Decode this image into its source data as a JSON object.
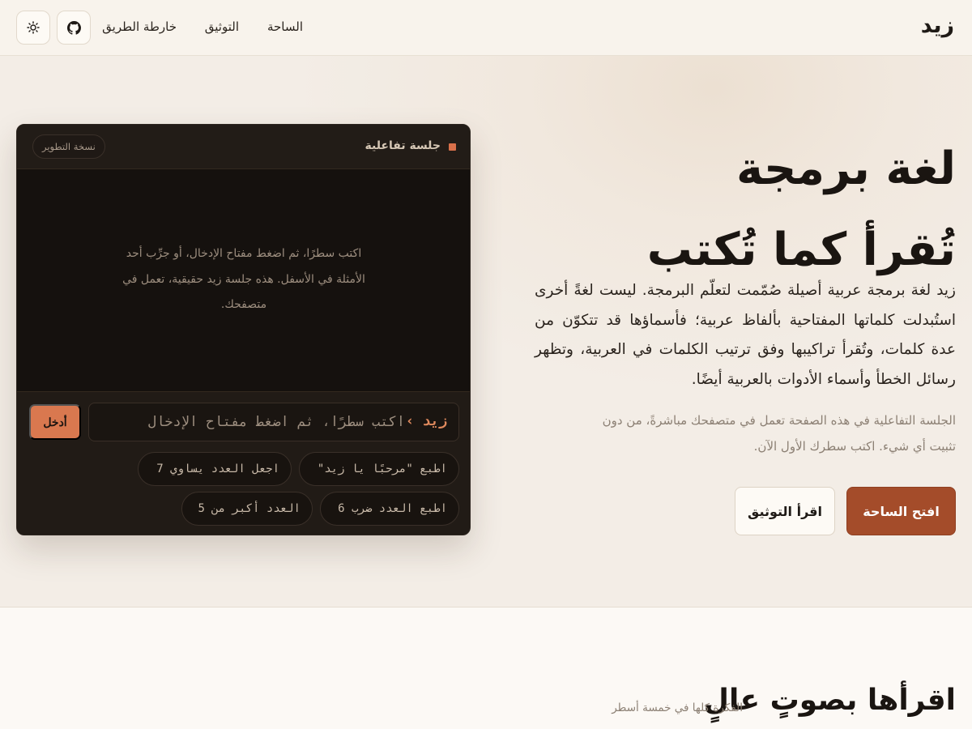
{
  "header": {
    "logo": "زيد",
    "nav": {
      "arena": "الساحة",
      "docs": "التوثيق",
      "roadmap": "خارطة الطريق"
    },
    "github_icon": "github-icon",
    "theme_icon": "sun-icon"
  },
  "hero": {
    "title_line1": "لغة برمجة",
    "title_line2": "تُقرأ كما تُكتب",
    "description": "زيد لغة برمجة عربية أصيلة صُمّمت لتعلّم البرمجة. ليست لغةً أخرى استُبدلت كلماتها المفتاحية بألفاظ عربية؛ فأسماؤها قد تتكوّن من عدة كلمات، وتُقرأ تراكيبها وفق ترتيب الكلمات في العربية، وتظهر رسائل الخطأ وأسماء الأدوات بالعربية أيضًا.",
    "note": "الجلسة التفاعلية في هذه الصفحة تعمل في متصفحك مباشرةً، من دون تثبيت أي شيء. اكتب سطرك الأول الآن.",
    "primary_button": "افتح الساحة",
    "secondary_button": "اقرأ التوثيق"
  },
  "repl": {
    "title": "جلسة تفاعلية",
    "badge": "نسخة التطوير",
    "hint": "اكتب سطرًا، ثم اضغط مفتاح الإدخال، أو جرِّب أحد الأمثلة في الأسفل. هذه جلسة زيد حقيقية، تعمل في متصفحك.",
    "prompt": "زيد ›",
    "input_placeholder": "اكتب سطرًا، ثم اضغط مفتاح الإدخال",
    "enter_button": "أدخل",
    "examples": [
      "اطبع \"مرحبًا يا زيد\"",
      "اجعل العدد يساوي 7",
      "اطبع العدد ضرب 6",
      "العدد أكبر من 5"
    ]
  },
  "next_section": {
    "title": "اقرأها بصوتٍ عالٍ",
    "subtitle": "الفكرة كلها في خمسة أسطر"
  },
  "colors": {
    "accent": "#a44c2a",
    "repl_accent": "#d9784f",
    "background": "#f8f3ec",
    "terminal": "#1c1713"
  }
}
